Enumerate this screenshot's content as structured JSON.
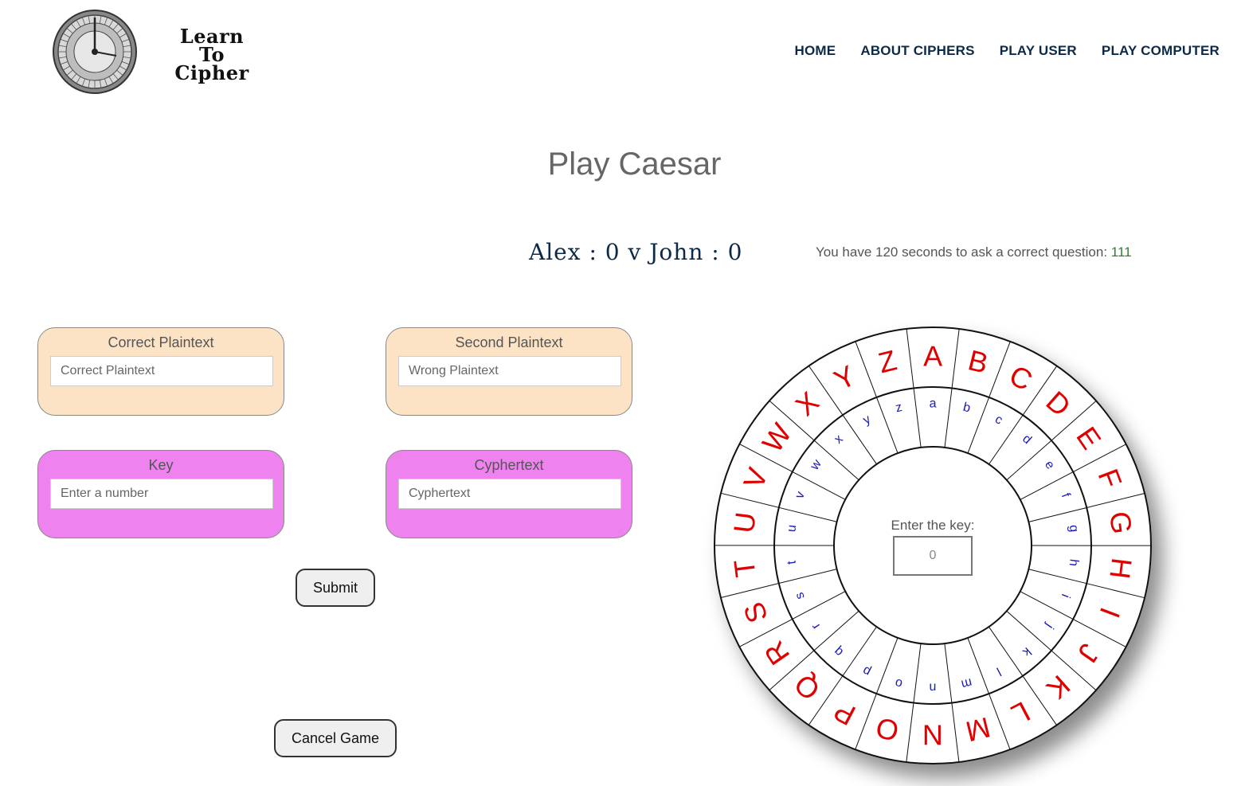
{
  "brand": {
    "logo_text": [
      "Learn",
      "To",
      "Cipher"
    ]
  },
  "nav": {
    "items": [
      "HOME",
      "ABOUT CIPHERS",
      "PLAY USER",
      "PLAY COMPUTER"
    ]
  },
  "page": {
    "title": "Play Caesar",
    "score": "Alex : 0 v John : 0",
    "timer_text": "You have 120 seconds to ask a correct question: ",
    "timer_count": "111"
  },
  "cards": {
    "correct_plaintext": {
      "label": "Correct Plaintext",
      "placeholder": "Correct Plaintext"
    },
    "second_plaintext": {
      "label": "Second Plaintext",
      "placeholder": "Wrong Plaintext"
    },
    "key": {
      "label": "Key",
      "placeholder": "Enter a number"
    },
    "cyphertext": {
      "label": "Cyphertext",
      "placeholder": "Cyphertext"
    }
  },
  "buttons": {
    "submit": "Submit",
    "cancel": "Cancel Game"
  },
  "wheel": {
    "outer_letters": [
      "A",
      "B",
      "C",
      "D",
      "E",
      "F",
      "G",
      "H",
      "I",
      "J",
      "K",
      "L",
      "M",
      "N",
      "O",
      "P",
      "Q",
      "R",
      "S",
      "T",
      "U",
      "V",
      "W",
      "X",
      "Y",
      "Z"
    ],
    "inner_letters": [
      "a",
      "b",
      "c",
      "d",
      "e",
      "f",
      "g",
      "h",
      "i",
      "j",
      "k",
      "l",
      "m",
      "n",
      "o",
      "p",
      "q",
      "r",
      "s",
      "t",
      "u",
      "v",
      "w",
      "x",
      "y",
      "z"
    ],
    "key_label": "Enter the key:",
    "key_placeholder": "0",
    "outer_color": "#e00000",
    "inner_color": "#1a1ab8"
  }
}
